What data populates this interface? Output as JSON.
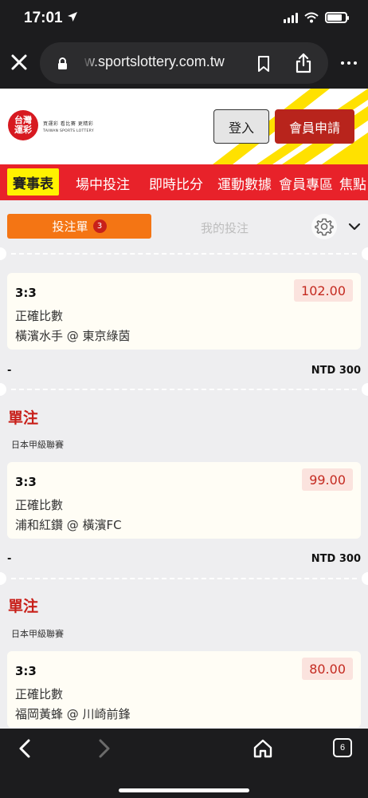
{
  "status_bar": {
    "time": "17:01"
  },
  "browser": {
    "url": "w.sportslottery.com.tw",
    "tab_count": "6"
  },
  "site": {
    "logo_text_line1": "台灣",
    "logo_text_line2": "運彩",
    "logo_slogan": "買運彩 看比賽 更精彩",
    "logo_english": "TAIWAN SPORTS LOTTERY",
    "login_label": "登入",
    "register_label": "會員申請"
  },
  "nav": {
    "items": [
      "賽事表",
      "場中投注",
      "即時比分",
      "運動數據",
      "會員專區",
      "焦點"
    ],
    "active_index": 0
  },
  "betslip": {
    "tab_betslip": "投注單",
    "badge_count": "3",
    "tab_mybets": "我的投注"
  },
  "bets": [
    {
      "section_title": "",
      "league": "",
      "score": "3:3",
      "market": "正確比數",
      "match": "橫濱水手 @ 東京綠茵",
      "odds": "102.00",
      "stake_left": "-",
      "stake": "NTD 300"
    },
    {
      "section_title": "單注",
      "league": "日本甲級聯賽",
      "score": "3:3",
      "market": "正確比數",
      "match": "浦和紅鑽 @ 橫濱FC",
      "odds": "99.00",
      "stake_left": "-",
      "stake": "NTD 300"
    },
    {
      "section_title": "單注",
      "league": "日本甲級聯賽",
      "score": "3:3",
      "market": "正確比數",
      "match": "福岡黃蜂 @ 川崎前鋒",
      "odds": "80.00"
    }
  ],
  "colors": {
    "nav_red": "#e8222a",
    "nav_active_yellow": "#fff200",
    "betslip_orange": "#f47514",
    "odds_red": "#c42a20",
    "register_red": "#b8241c"
  }
}
